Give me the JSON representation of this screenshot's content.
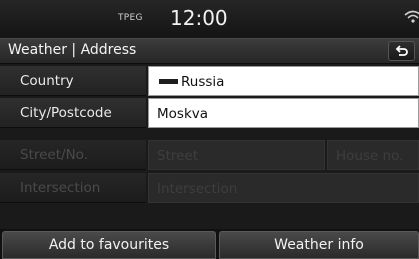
{
  "status": {
    "source": "TPEG",
    "time": "12:00"
  },
  "header": {
    "title": "Weather | Address"
  },
  "form": {
    "country_label": "Country",
    "country_value": "Russia",
    "city_label": "City/Postcode",
    "city_value": "Moskva",
    "street_label": "Street/No.",
    "street_placeholder": "Street",
    "house_placeholder": "House no.",
    "intersection_label": "Intersection",
    "intersection_placeholder": "Intersection"
  },
  "actions": {
    "favourites_label": "Add to favourites",
    "weather_label": "Weather info"
  },
  "icons": {
    "back": "back-return-icon",
    "wifi": "wifi-icon",
    "flag": "flag-icon"
  }
}
